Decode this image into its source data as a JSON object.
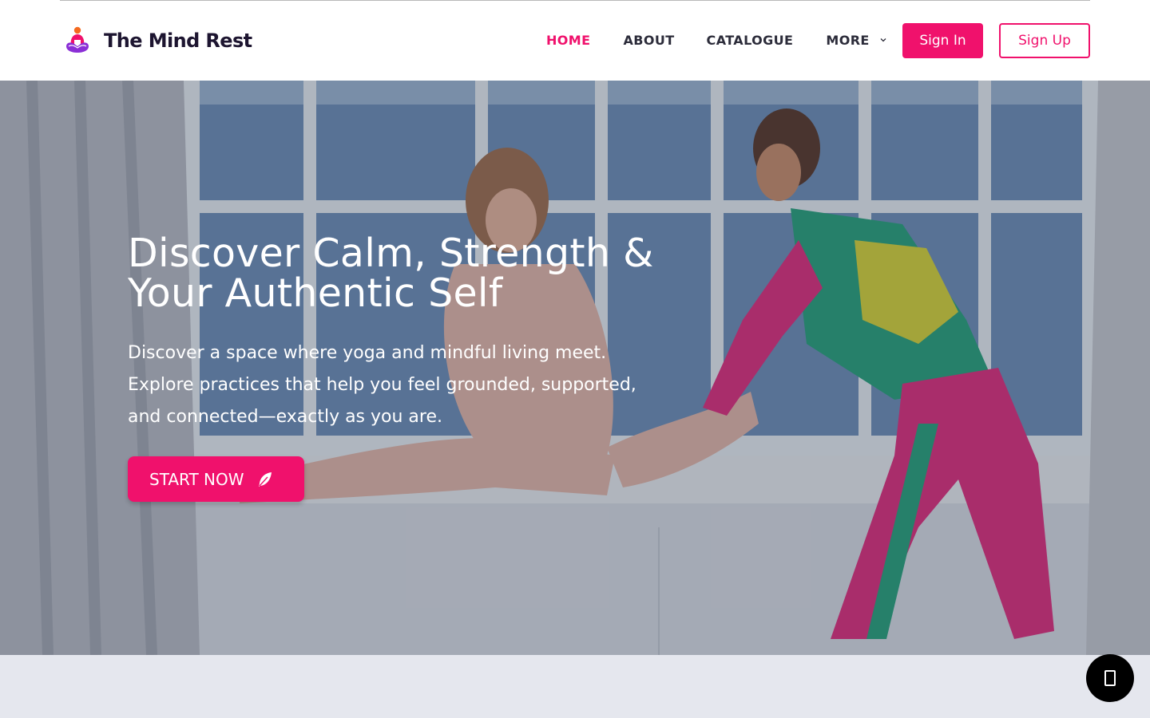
{
  "brand": {
    "name": "The Mind Rest",
    "logo_icon": "meditation-figure-icon"
  },
  "nav": {
    "items": [
      {
        "label": "HOME",
        "active": true
      },
      {
        "label": "ABOUT",
        "active": false
      },
      {
        "label": "CATALOGUE",
        "active": false
      },
      {
        "label": "MORE",
        "active": false,
        "has_dropdown": true
      }
    ],
    "sign_in": "Sign In",
    "sign_up": "Sign Up"
  },
  "hero": {
    "title": "Discover Calm, Strength & Your Authentic Self",
    "text": "Discover a space where yoga and mindful living meet. Explore practices that help you feel grounded, supported, and connected—exactly as you are.",
    "cta": "START NOW",
    "cta_icon": "feather-icon"
  },
  "colors": {
    "accent": "#f0116c",
    "nav_text": "#2c2c3a",
    "section_bg": "#e5e7ee",
    "fab_bg": "#000000"
  }
}
